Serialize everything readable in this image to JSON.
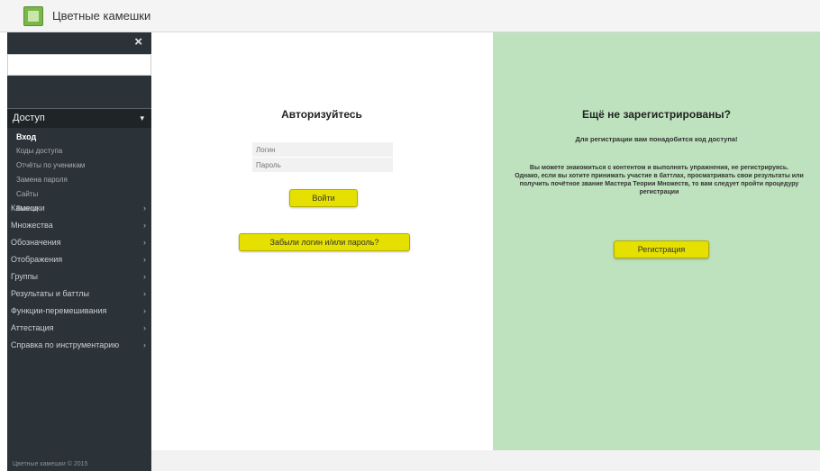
{
  "app": {
    "title": "Цветные камешки"
  },
  "sidebar": {
    "close": "×",
    "section": {
      "label": "Доступ",
      "arrow": "▾"
    },
    "sub_items": [
      {
        "label": "Вход",
        "active": true
      },
      {
        "label": "Коды доступа"
      },
      {
        "label": "Отчёты по ученикам"
      },
      {
        "label": "Замена пароля"
      },
      {
        "label": "Сайты"
      },
      {
        "label": "Выход"
      }
    ],
    "menu_items": [
      {
        "label": "Камешки"
      },
      {
        "label": "Множества"
      },
      {
        "label": "Обозначения"
      },
      {
        "label": "Отображения"
      },
      {
        "label": "Группы"
      },
      {
        "label": "Результаты и баттлы"
      },
      {
        "label": "Функции-перемешивания"
      },
      {
        "label": "Аттестация"
      },
      {
        "label": "Справка по инструментарию"
      }
    ],
    "chevron": "›",
    "footer": "Цветные камешки © 2015"
  },
  "login": {
    "title": "Авторизуйтесь",
    "login_placeholder": "Логин",
    "password_placeholder": "Пароль",
    "login_button": "Войти",
    "forgot_button": "Забыли логин и/или пароль?"
  },
  "register": {
    "title": "Ещё не зарегистрированы?",
    "note": "Для регистрации вам понадобится код доступа!",
    "text_line1": "Вы можете знакомиться с контентом и выполнять упражнения, не регистрируясь.",
    "text_line2": "Однако, если вы хотите принимать участие в баттлах, просматривать свои результаты или получить почётное звание Мастера Теории Множеств, то вам следует пройти процедуру регистрации",
    "button": "Регистрация"
  },
  "colors": {
    "sidebar_bg": "#2c3338",
    "accent_yellow": "#e5e000",
    "register_panel_bg": "#bde2bd"
  }
}
